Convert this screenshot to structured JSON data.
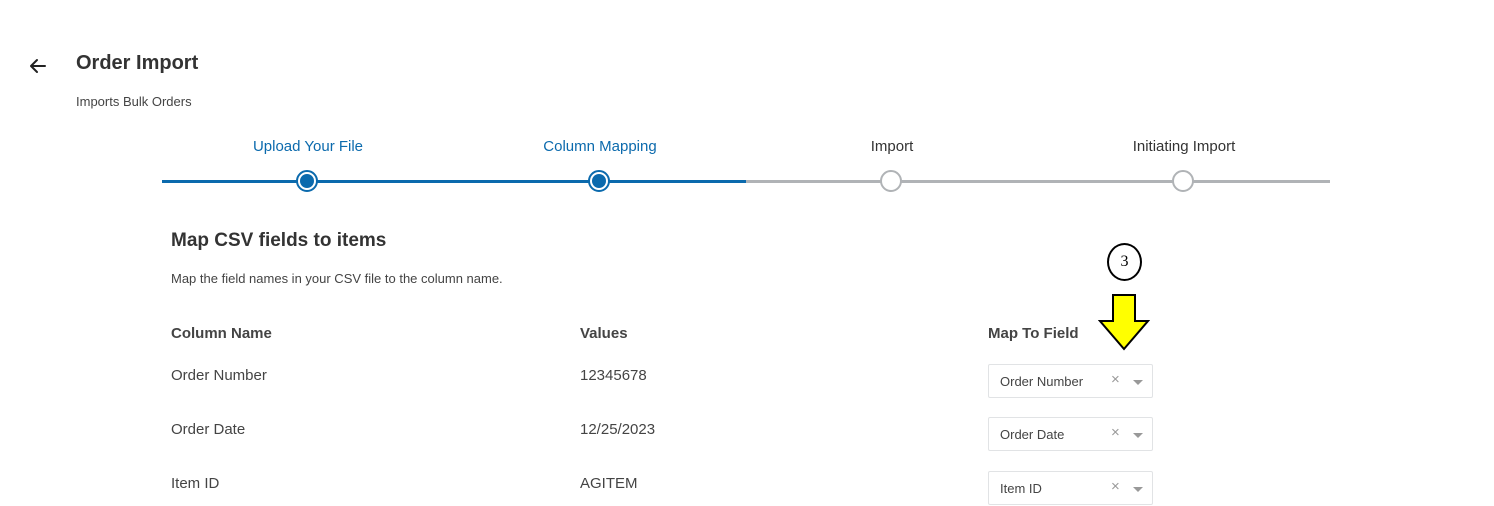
{
  "header": {
    "title": "Order Import",
    "subtitle": "Imports Bulk Orders"
  },
  "stepper": {
    "steps": [
      {
        "label": "Upload Your File",
        "state": "done"
      },
      {
        "label": "Column Mapping",
        "state": "done"
      },
      {
        "label": "Import",
        "state": "todo"
      },
      {
        "label": "Initiating Import",
        "state": "todo"
      }
    ],
    "completed_fraction": 0.5
  },
  "mapping": {
    "title": "Map CSV fields to items",
    "description": "Map the field names in your CSV file to the column name.",
    "columns": {
      "column_name": "Column Name",
      "values": "Values",
      "map_to_field": "Map To Field"
    },
    "rows": [
      {
        "column_name": "Order Number",
        "value": "12345678",
        "mapped_field": "Order Number"
      },
      {
        "column_name": "Order Date",
        "value": "12/25/2023",
        "mapped_field": "Order Date"
      },
      {
        "column_name": "Item ID",
        "value": "AGITEM",
        "mapped_field": "Item ID"
      }
    ],
    "clear_glyph": "×"
  },
  "annotation": {
    "number": "3",
    "arrow_color": "#ffff00"
  },
  "colors": {
    "accent": "#0b6aad",
    "inactive": "#b0b3b6"
  },
  "icons": {
    "back": "arrow-left-icon",
    "clear": "close-icon",
    "caret": "caret-down-icon"
  }
}
